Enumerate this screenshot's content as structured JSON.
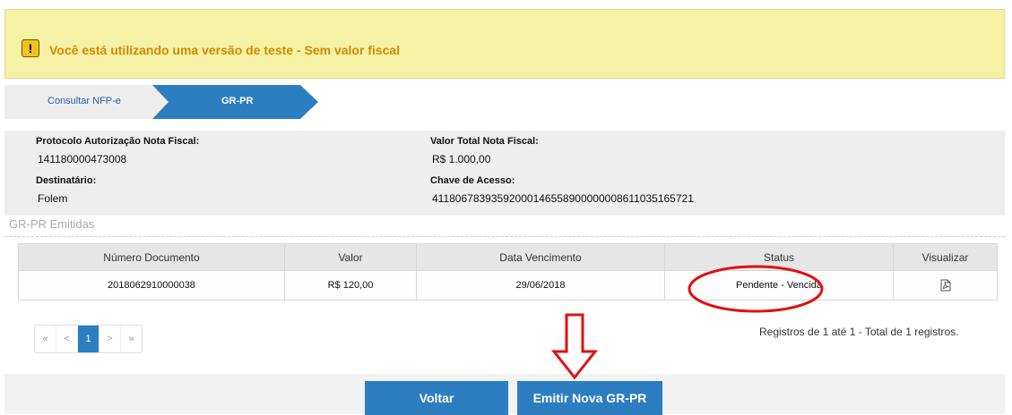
{
  "warning": {
    "icon": "warning-icon",
    "text": "Você está utilizando uma versão de teste - Sem valor fiscal"
  },
  "breadcrumb": [
    {
      "label": "Consultar NFP-e"
    },
    {
      "label": "GR-PR"
    }
  ],
  "info": {
    "protocolo_label": "Protocolo Autorização Nota Fiscal:",
    "protocolo_value": "141180000473008",
    "valor_label": "Valor Total Nota Fiscal:",
    "valor_value": "R$ 1.000,00",
    "destinatario_label": "Destinatário:",
    "destinatario_value": "Folem",
    "chave_label": "Chave de Acesso:",
    "chave_value": "41180678393592000146558900000008611035165721"
  },
  "section_title": "GR-PR Emitidas",
  "table": {
    "headers": [
      "Número Documento",
      "Valor",
      "Data Vencimento",
      "Status",
      "Visualizar"
    ],
    "rows": [
      {
        "numero": "2018062910000038",
        "valor": "R$ 120,00",
        "vencimento": "29/06/2018",
        "status": "Pendente - Vencida",
        "visualizar_icon": "pdf-icon"
      }
    ]
  },
  "pagination": {
    "first": "«",
    "prev": "<",
    "current": "1",
    "next": ">",
    "last": "»"
  },
  "registros_text": "Registros de 1 até 1 - Total de 1 registros.",
  "buttons": {
    "voltar": "Voltar",
    "emitir": "Emitir Nova GR-PR"
  },
  "colors": {
    "accent": "#2d7ec0",
    "warning_bg": "#f5f1a5",
    "warning_text": "#d08a00",
    "annotation_red": "#e01010"
  }
}
